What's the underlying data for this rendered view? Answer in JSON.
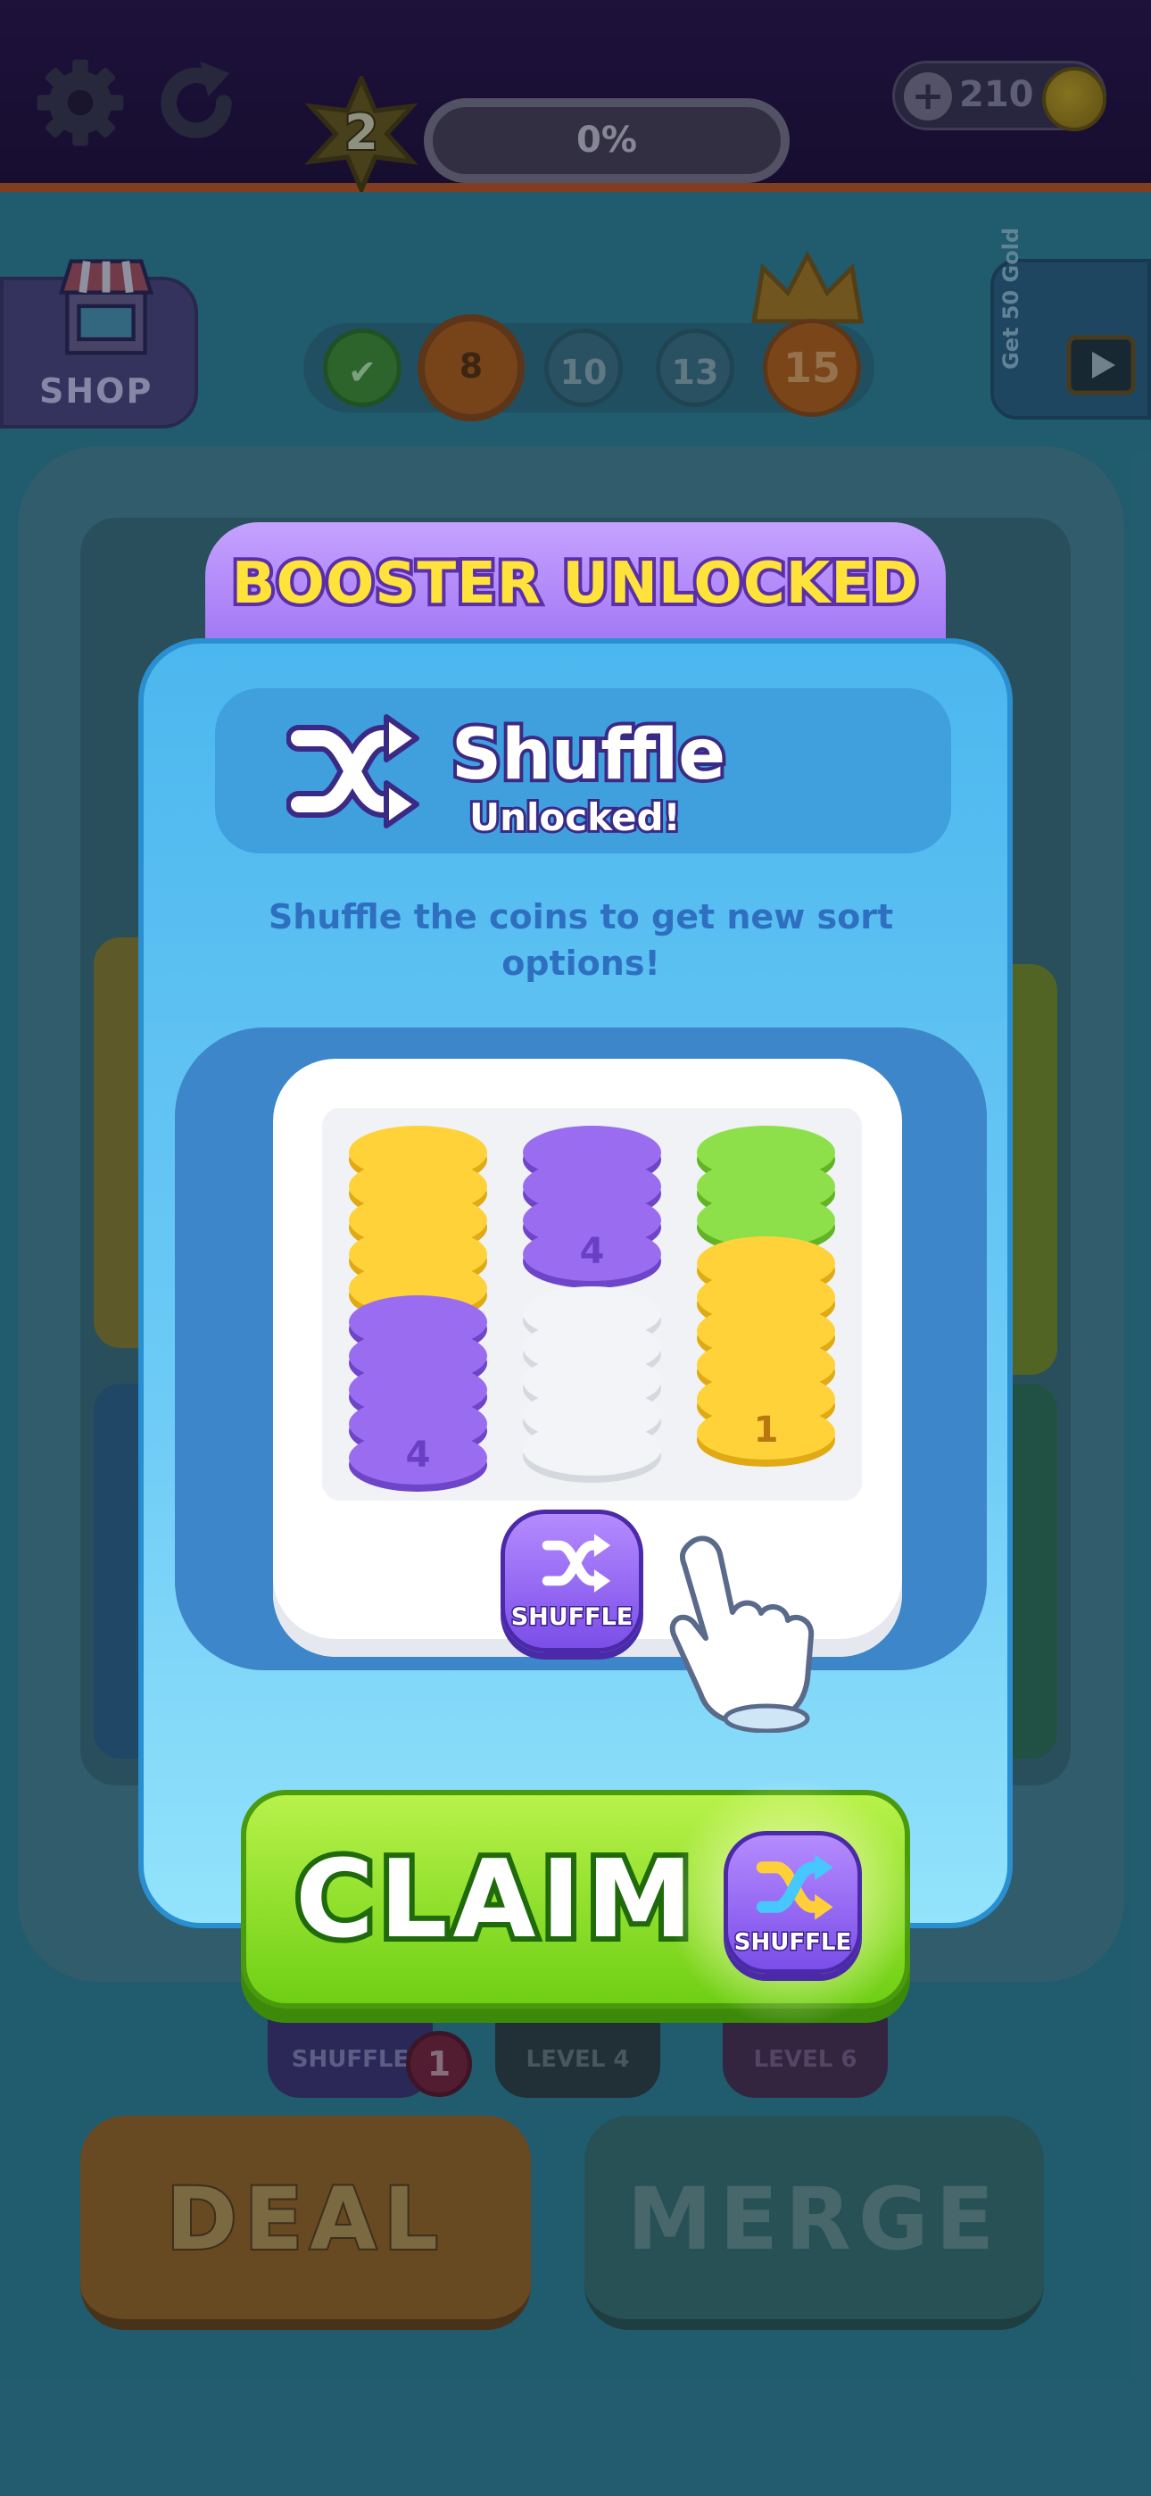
{
  "hud": {
    "level": "2",
    "progress_text": "0%",
    "coins": "210",
    "coin_plus": "+"
  },
  "map": {
    "shop_label": "SHOP",
    "stages": [
      "8",
      "10",
      "13",
      "15"
    ],
    "gold_ad_text": "Get 50 Gold"
  },
  "boosters": {
    "shuffle_label": "SHUFFLE",
    "shuffle_count": "1",
    "level4_label": "LEVEL 4",
    "level6_label": "LEVEL 6"
  },
  "actions": {
    "deal_label": "DEAL",
    "merge_label": "MERGE"
  },
  "modal": {
    "title": "BOOSTER UNLOCKED",
    "feature_name": "Shuffle",
    "feature_status": "Unlocked!",
    "description": "Shuffle the coins to get new sort options!",
    "preview": {
      "column1_count": "4",
      "column2_count": "4",
      "column3_count": "1",
      "shuffle_button_label": "SHUFFLE"
    },
    "claim_label": "CLAIM",
    "claim_booster_label": "SHUFFLE"
  },
  "colors": {
    "yellow_coin": "#ffd23a",
    "purple_coin": "#9a6cf0",
    "green_coin": "#8ee04a",
    "white_coin": "#f3f4f8",
    "claim_green": "#7ed81c",
    "modal_blue": "#4cb7ee"
  }
}
